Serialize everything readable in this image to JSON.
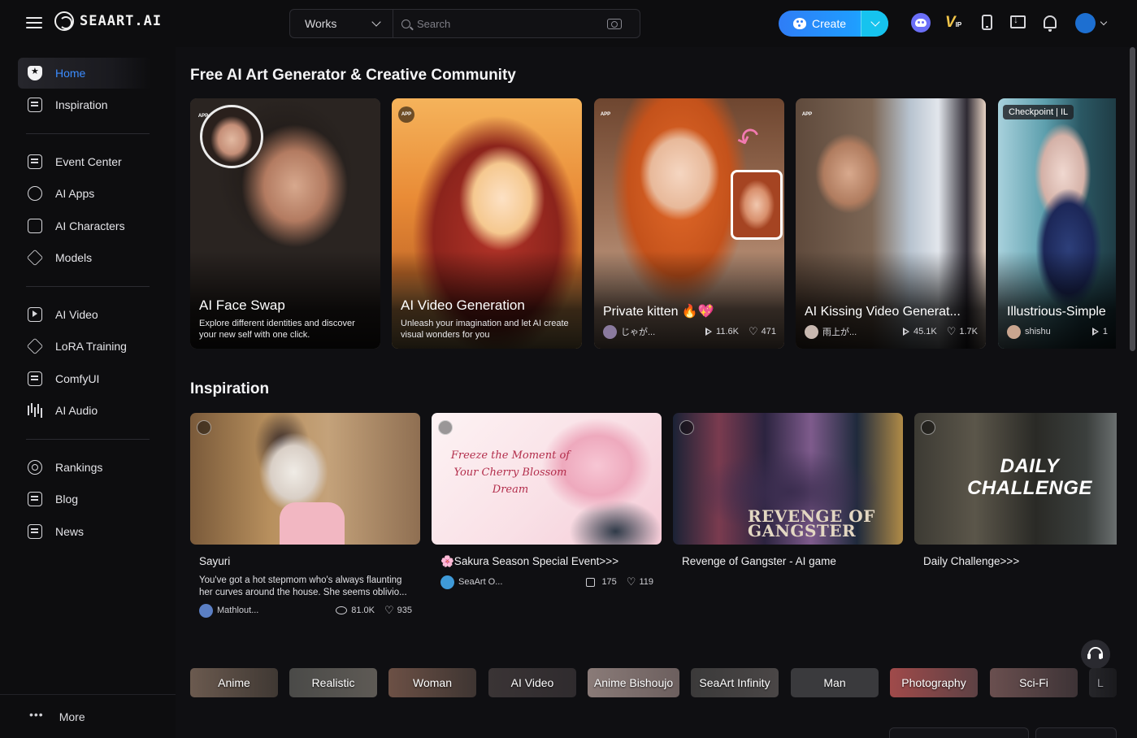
{
  "brand": {
    "logo_text": "SEAART.AI"
  },
  "search": {
    "filter_value": "Works",
    "placeholder": "Search"
  },
  "header": {
    "create_label": "Create",
    "vip_label": "V",
    "vip_sub": "IP"
  },
  "sidebar": {
    "items": [
      {
        "label": "Home",
        "icon": "home-icon",
        "active": true
      },
      {
        "label": "Inspiration",
        "icon": "inspiration-icon"
      },
      {
        "label": "Event Center",
        "icon": "event-icon"
      },
      {
        "label": "AI Apps",
        "icon": "ai-apps-icon"
      },
      {
        "label": "AI Characters",
        "icon": "ai-characters-icon"
      },
      {
        "label": "Models",
        "icon": "cube-icon"
      },
      {
        "label": "AI Video",
        "icon": "video-icon"
      },
      {
        "label": "LoRA Training",
        "icon": "training-icon"
      },
      {
        "label": "ComfyUI",
        "icon": "comfyui-icon"
      },
      {
        "label": "AI Audio",
        "icon": "audio-icon"
      },
      {
        "label": "Rankings",
        "icon": "medal-icon"
      },
      {
        "label": "Blog",
        "icon": "blog-icon"
      },
      {
        "label": "News",
        "icon": "news-icon"
      }
    ],
    "more_label": "More",
    "more_dots": "•••",
    "accent_color": "#3b8cff"
  },
  "hero": {
    "title": "Free AI Art Generator & Creative Community",
    "cards": [
      {
        "badge": "APP",
        "title": "AI Face Swap",
        "desc": "Explore different identities and discover your new self with one click."
      },
      {
        "badge": "APP",
        "title": "AI Video Generation",
        "desc": "Unleash your imagination and let AI create visual wonders for you"
      },
      {
        "badge": "APP",
        "title": "Private kitten 🔥💖",
        "user": "じゃが...",
        "views": "11.6K",
        "likes": "471"
      },
      {
        "badge": "APP",
        "title": "AI Kissing Video Generat...",
        "user": "雨上が...",
        "views": "45.1K",
        "likes": "1.7K"
      },
      {
        "badge": "Checkpoint | IL",
        "title": "Illustrious-Simple",
        "user": "shishu",
        "views": "1"
      }
    ]
  },
  "inspiration": {
    "title": "Inspiration",
    "cards": [
      {
        "title": "Sayuri",
        "desc": "You've got a hot stepmom who's always flaunting her curves around the house. She seems oblivio...",
        "user": "Mathlout...",
        "chats": "81.0K",
        "likes": "935"
      },
      {
        "title": "🌸Sakura Season Special Event>>>",
        "image_text": "Freeze the Moment of Your Cherry Blossom Dream",
        "user": "SeaArt O...",
        "thumbs": "175",
        "likes": "119"
      },
      {
        "title": "Revenge of Gangster - AI game",
        "image_text": "REVENGE OF GANGSTER"
      },
      {
        "title": "Daily Challenge>>>",
        "image_text": "DAILY CHALLENGE"
      }
    ]
  },
  "chips": [
    "Anime",
    "Realistic",
    "Woman",
    "AI Video",
    "Anime Bishoujo",
    "SeaArt Infinity",
    "Man",
    "Photography",
    "Sci-Fi",
    "L"
  ],
  "colors": {
    "create_gradient_start": "#2f7df6",
    "create_gradient_end": "#18c8ff",
    "vip": "#f3c64a",
    "discord": "#6b6ff8"
  }
}
